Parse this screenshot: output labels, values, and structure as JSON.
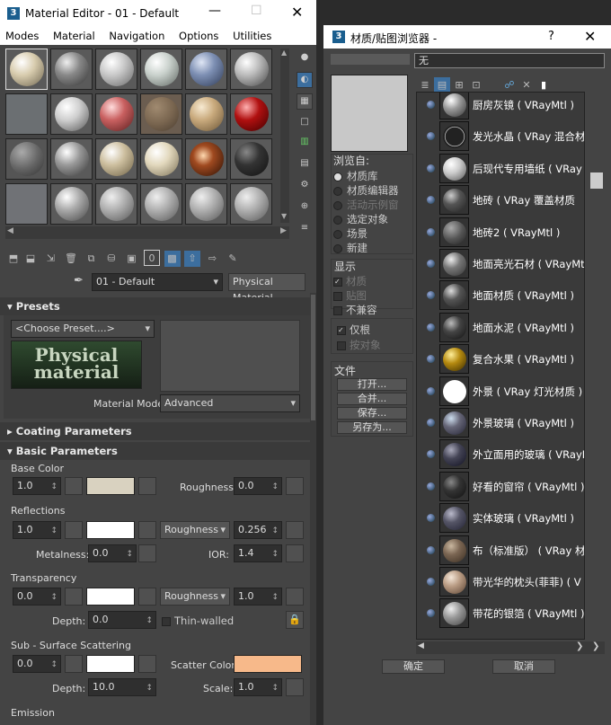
{
  "material_editor": {
    "title": "Material Editor - 01 - Default",
    "menu": [
      "Modes",
      "Material",
      "Navigation",
      "Options",
      "Utilities"
    ],
    "material_name": "01 - Default",
    "material_type": "Physical Material",
    "presets": {
      "header": "Presets",
      "choose_preset": "<Choose Preset....>",
      "logo_text": "Physical material",
      "mode_label": "Material Mode:",
      "mode_value": "Advanced"
    },
    "coating_header": "Coating Parameters",
    "basic_header": "Basic Parameters",
    "base_color": {
      "label": "Base Color",
      "weight": "1.0",
      "roughness_label": "Roughness:",
      "roughness": "0.0",
      "color": "#d9d2c0"
    },
    "reflections": {
      "label": "Reflections",
      "weight": "1.0",
      "mode": "Roughness",
      "value": "0.256",
      "metalness_label": "Metalness:",
      "metalness": "0.0",
      "ior_label": "IOR:",
      "ior": "1.4"
    },
    "transparency": {
      "label": "Transparency",
      "weight": "0.0",
      "mode": "Roughness",
      "value": "1.0",
      "depth_label": "Depth:",
      "depth": "0.0",
      "thin_walled": "Thin-walled"
    },
    "sss": {
      "label": "Sub - Surface Scattering",
      "weight": "0.0",
      "scatter_label": "Scatter Color:",
      "scatter_color": "#f7b98a",
      "depth_label": "Depth:",
      "depth": "10.0",
      "scale_label": "Scale:",
      "scale": "1.0"
    },
    "emission_label": "Emission"
  },
  "browser": {
    "title": "材质/贴图浏览器 -",
    "help": "?",
    "filter_text": "无",
    "browse_from": {
      "label": "浏览自:",
      "options": [
        {
          "text": "材质库",
          "state": "sel"
        },
        {
          "text": "材质编辑器",
          "state": ""
        },
        {
          "text": "活动示例窗",
          "state": "dis"
        },
        {
          "text": "选定对象",
          "state": ""
        },
        {
          "text": "场景",
          "state": ""
        },
        {
          "text": "新建",
          "state": ""
        }
      ]
    },
    "display": {
      "label": "显示",
      "options": [
        {
          "text": "材质",
          "state": "on dis"
        },
        {
          "text": "贴图",
          "state": "dis"
        },
        {
          "text": "不兼容",
          "state": ""
        }
      ]
    },
    "root_only": "仅根",
    "by_object": "按对象",
    "file": {
      "label": "文件",
      "buttons": [
        "打开...",
        "合并...",
        "保存...",
        "另存为..."
      ]
    },
    "items": [
      "厨房灰镜 ( VRayMtl )",
      "发光水晶 ( VRay 混合材",
      "后现代专用墙纸 ( VRay",
      "地砖 ( VRay 覆盖材质",
      "地砖2 ( VRayMtl )",
      "地面亮光石材 ( VRayMtl",
      "地面材质 ( VRayMtl )",
      "地面水泥 ( VRayMtl )",
      "复合水果 ( VRayMtl )",
      "外景 ( VRay 灯光材质 )",
      "外景玻璃 ( VRayMtl )",
      "外立面用的玻璃 ( VRayM",
      "好看的窗帘 ( VRayMtl )",
      "实体玻璃 ( VRayMtl )",
      "布（标准版） ( VRay 材",
      "带光华的枕头(菲菲) ( V",
      "带花的银箔 ( VRayMtl )"
    ],
    "ok": "确定",
    "cancel": "取消"
  }
}
